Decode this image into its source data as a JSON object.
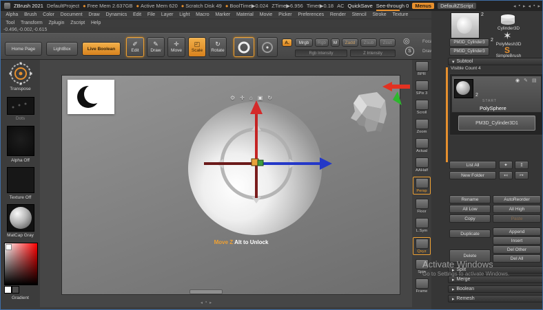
{
  "colors": {
    "accent": "#e7902e"
  },
  "icons": {
    "media_prev": "◂",
    "media_stop": "▪",
    "media_next": "▸",
    "edit_glyph": "✐",
    "draw_glyph": "✎",
    "move_glyph": "✛",
    "scale_glyph": "◰",
    "rotate_glyph": "↻",
    "dial_glyph": "◎",
    "s_dial": "S",
    "gizmo_gear": "⚙",
    "gizmo_pin": "✛",
    "gizmo_home": "⌂",
    "gizmo_lock": "▣",
    "gizmo_reset": "↻",
    "subtool_eye": "◉",
    "subtool_brush": "✎",
    "subtool_more": "▤",
    "star": "✶",
    "diamond": "✦",
    "up_arrow": "↥",
    "left_arrow": "↤",
    "right_arrow": "↦",
    "header_arrow": "▾",
    "section_arrow": "▸"
  },
  "titlebar": {
    "app_name": "ZBrush 2021",
    "project": "DefaultProject",
    "stats": [
      {
        "dot": "●",
        "text": "Free Mem 2.637GB"
      },
      {
        "dot": "●",
        "text": "Active Mem 620"
      },
      {
        "dot": "●",
        "text": "Scratch Disk 49"
      },
      {
        "dot": "●",
        "text": "BoolTime▶0.024"
      },
      {
        "dot": "",
        "text": "ZTime▶6.956"
      },
      {
        "dot": "",
        "text": "Timer▶0.18"
      },
      {
        "dot": "",
        "text": "AC"
      }
    ],
    "quicksave": "QuickSave",
    "see_through": "See-through 0",
    "menus_button": "Menus",
    "zscript_name": "DefaultZScript"
  },
  "menubar": {
    "row1": [
      "Alpha",
      "Brush",
      "Color",
      "Document",
      "Draw",
      "Dynamics",
      "Edit",
      "File",
      "Layer",
      "Light",
      "Macro",
      "Marker",
      "Material",
      "Movie",
      "Picker",
      "Preferences",
      "Render",
      "Stencil",
      "Stroke",
      "Texture"
    ],
    "row2": [
      "Tool",
      "Transform",
      "Zplugin",
      "Zscript",
      "Help"
    ]
  },
  "coordinates_readout": "-0.496,-0.002,-0.615",
  "toolbar": {
    "home_page": "Home Page",
    "lightbox": "LightBox",
    "live_boolean": "Live Boolean",
    "edit": "Edit",
    "draw": "Draw",
    "move": "Move",
    "scale": "Scale",
    "rotate": "Rotate",
    "paint_badge": "A.",
    "mrgb": "Mrgb",
    "rgb": "Rgb",
    "m": "M",
    "zadd": "Zadd",
    "zsub": "Zsub",
    "zcut": "Zcut",
    "rgb_intensity": "Rgb Intensity",
    "z_intensity": "Z Intensity",
    "focal_shift": "Foca",
    "draw_size": "Draw"
  },
  "left_shelf": {
    "transpose": "Transpose",
    "dots": "Dots",
    "alpha_off": "Alpha Off",
    "texture_off": "Texture Off",
    "matcap": "MatCap Gray",
    "gradient": "Gradient"
  },
  "canvas": {
    "hint_action": "Move Z",
    "hint_suffix": "Alt to Unlock"
  },
  "right_shelf": {
    "items": [
      {
        "label": "BPR"
      },
      {
        "label": "SPix 3"
      },
      {
        "label": "Scroll"
      },
      {
        "label": "Zoom"
      },
      {
        "label": "Actual"
      },
      {
        "label": "AAHalf"
      },
      {
        "label": "Persp"
      },
      {
        "label": "Floor"
      },
      {
        "label": "L.Sym"
      },
      {
        "label": "Qxyz"
      },
      {
        "label": "Spin"
      },
      {
        "label": "Frame"
      }
    ]
  },
  "tool_panel": {
    "current_tool_badge": "2",
    "recent_badge": "2",
    "cylinder3d": "Cylinder3D",
    "polymesh3d": "PolyMesh3D",
    "simplebrush": "SimpleBrush",
    "simplebrush_glyph": "S",
    "recent_tool_1": "PM3D_Cylinder3",
    "recent_tool_2": "PM3D_Cylinder3",
    "subtool": {
      "header": "Subtool",
      "visible_count": "Visible Count 4",
      "selected_badge": "2",
      "selected_tag": "START",
      "selected_name": "PolySphere",
      "second_item": "PM3D_Cylinder3D1",
      "list_all": "List All",
      "new_folder": "New Folder",
      "buttons_left": [
        "Rename",
        "All Low",
        "Copy",
        "Duplicate",
        "Delete"
      ],
      "buttons_right": [
        "AutoReorder",
        "All High",
        "Paste",
        "Append",
        "Insert",
        "Del Other",
        "Del All"
      ],
      "sections": [
        "Split",
        "Merge",
        "Boolean",
        "Remesh"
      ]
    }
  },
  "watermark": {
    "line1": "Activate Windows",
    "line2": "Go to Settings to activate Windows."
  }
}
